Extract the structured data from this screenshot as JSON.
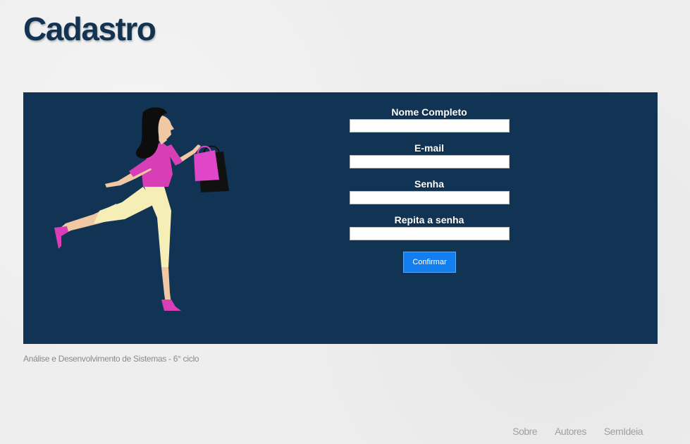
{
  "header": {
    "title": "Cadastro"
  },
  "form": {
    "fields": [
      {
        "label": "Nome Completo",
        "value": ""
      },
      {
        "label": "E-mail",
        "value": ""
      },
      {
        "label": "Senha",
        "value": ""
      },
      {
        "label": "Repita a senha",
        "value": ""
      }
    ],
    "submit_label": "Confirmar"
  },
  "footer": {
    "caption": "Análise e Desenvolvimento de Sistemas - 6° ciclo",
    "nav": [
      "Sobre",
      "Autores",
      "SemIdeia"
    ]
  },
  "colors": {
    "panel": "#123454",
    "title": "#123452",
    "button": "#137ef0",
    "skin": "#f0c9a4",
    "top": "#d83fb6",
    "pants": "#f5eeb7",
    "bag_pink": "#e046c8",
    "bag_black": "#111111",
    "hair": "#0d0d0d"
  },
  "icons": {
    "illustration": "woman-with-shopping-bags-illustration"
  }
}
